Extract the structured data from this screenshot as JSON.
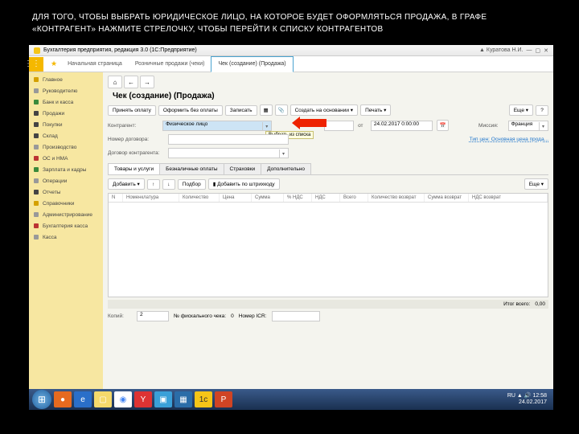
{
  "slide_title": "ДЛЯ ТОГО, ЧТОБЫ ВЫБРАТЬ ЮРИДИЧЕСКОЕ ЛИЦО, НА КОТОРОЕ БУДЕТ ОФОРМЛЯТЬСЯ ПРОДАЖА, В ГРАФЕ «КОНТРАГЕНТ» НАЖМИТЕ СТРЕЛОЧКУ, ЧТОБЫ ПЕРЕЙТИ К СПИСКУ КОНТРАГЕНТОВ",
  "window_title": "Бухгалтерия предприятия, редакция 3.0   (1С:Предприятие)",
  "user_label": "Куратова Н.И.",
  "top_tabs": {
    "t0": "Начальная страница",
    "t1": "Розничные продажи (чеки)",
    "t2": "Чек (создание) (Продажа)"
  },
  "sidebar": {
    "i0": "Главное",
    "i1": "Руководителю",
    "i2": "Банк и касса",
    "i3": "Продажи",
    "i4": "Покупки",
    "i5": "Склад",
    "i6": "Производство",
    "i7": "ОС и НМА",
    "i8": "Зарплата и кадры",
    "i9": "Операции",
    "i10": "Отчеты",
    "i11": "Справочники",
    "i12": "Администрирование",
    "i13": "Бухгалтерия касса",
    "i14": "Касса"
  },
  "doc_title": "Чек (создание) (Продажа)",
  "toolbar": {
    "b0": "Принять оплату",
    "b1": "Оформить без оплаты",
    "b2": "Записать",
    "b3": "Создать на основании ▾",
    "b4": "Печать ▾",
    "more": "Еще ▾"
  },
  "form": {
    "l_contragent": "Контрагент:",
    "v_contragent": "Физическое лицо",
    "l_num": "Номер договора:",
    "l_contract": "Договор контрагента:",
    "l_ot": "от",
    "v_date": "24.02.2017  0:00:00",
    "l_mission": "Миссия:",
    "v_mission": "Франция",
    "tooltip": "Выбрать из списка",
    "link_price": "Тип цен: Основная цена прода..."
  },
  "tabs2": {
    "t0": "Товары и услуги",
    "t1": "Безналичные оплаты",
    "t2": "Страховки",
    "t3": "Дополнительно"
  },
  "subbar": {
    "b0": "Добавить ▾",
    "b1": "Подбор",
    "b2": "Добавить по штрихкоду",
    "more": "Еще ▾"
  },
  "thead": {
    "c0": "N",
    "c1": "Номенклатура",
    "c2": "Количество",
    "c3": "Цена",
    "c4": "Сумма",
    "c5": "% НДС",
    "c6": "НДС",
    "c7": "Всего",
    "c8": "Количество возврат",
    "c9": "Сумма возврат",
    "c10": "НДС возврат"
  },
  "footer": {
    "total_lbl": "Итог всего:",
    "total_val": "0,00"
  },
  "copies": {
    "l0": "Копий:",
    "v0": "2",
    "l1": "№ фискального чека:",
    "v1": "0",
    "l2": "Номер ICR:"
  },
  "tray": {
    "lang": "RU",
    "time": "12:58",
    "date": "24.02.2017"
  }
}
